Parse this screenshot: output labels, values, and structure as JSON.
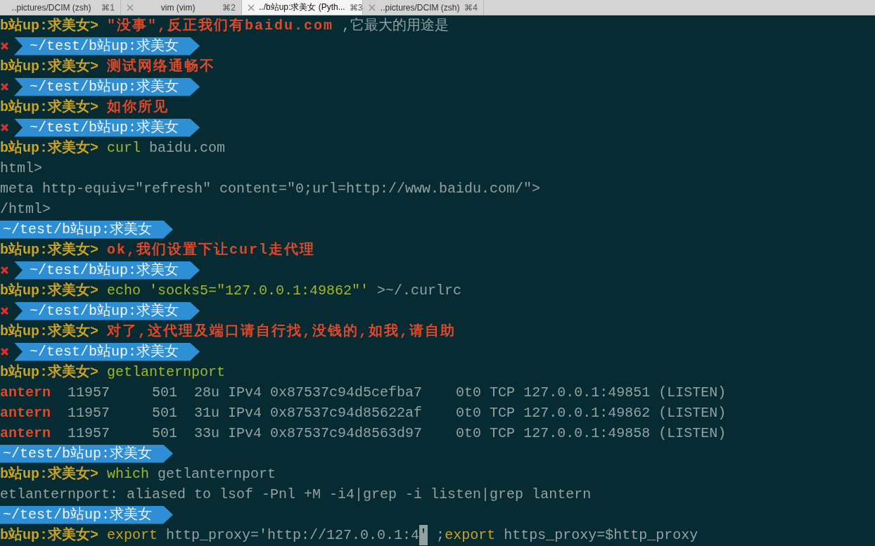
{
  "tabs": [
    {
      "label": "..pictures/DCIM (zsh)",
      "shortcut": "⌘1",
      "closable": false,
      "selected": false
    },
    {
      "label": "vim (vim)",
      "shortcut": "⌘2",
      "closable": true,
      "selected": false
    },
    {
      "label": "../b站up:求美女 (Pyth...",
      "shortcut": "⌘3",
      "closable": true,
      "selected": true
    },
    {
      "label": "..pictures/DCIM (zsh)",
      "shortcut": "⌘4",
      "closable": true,
      "selected": false
    }
  ],
  "lines": [
    {
      "kind": "prompt",
      "prompt": "b站up:求美女>",
      "segments": [
        {
          "kind": "comment",
          "text": "\"没事\",反正我们有baidu.com"
        },
        {
          "kind": "plain",
          "text": " ,它最大的用途是"
        }
      ]
    },
    {
      "kind": "path",
      "failed": true,
      "path": "~/test/b站up:求美女"
    },
    {
      "kind": "prompt",
      "prompt": "b站up:求美女>",
      "segments": [
        {
          "kind": "comment",
          "text": "测试网络通畅不"
        }
      ]
    },
    {
      "kind": "path",
      "failed": true,
      "path": "~/test/b站up:求美女"
    },
    {
      "kind": "prompt",
      "prompt": "b站up:求美女>",
      "segments": [
        {
          "kind": "comment",
          "text": "如你所见"
        }
      ]
    },
    {
      "kind": "path",
      "failed": true,
      "path": "~/test/b站up:求美女"
    },
    {
      "kind": "prompt",
      "prompt": "b站up:求美女>",
      "segments": [
        {
          "kind": "command",
          "text": "curl"
        },
        {
          "kind": "plain",
          "text": " baidu.com"
        }
      ]
    },
    {
      "kind": "output",
      "segments": [
        {
          "kind": "plain",
          "text": "html>"
        }
      ]
    },
    {
      "kind": "output",
      "segments": [
        {
          "kind": "plain",
          "text": "meta http-equiv=\"refresh\" content=\"0;url=http://www.baidu.com/\">"
        }
      ]
    },
    {
      "kind": "output",
      "segments": [
        {
          "kind": "plain",
          "text": "/html>"
        }
      ]
    },
    {
      "kind": "path",
      "failed": false,
      "path": "~/test/b站up:求美女"
    },
    {
      "kind": "prompt",
      "prompt": "b站up:求美女>",
      "segments": [
        {
          "kind": "comment",
          "text": "ok,我们设置下让curl走代理"
        }
      ]
    },
    {
      "kind": "path",
      "failed": true,
      "path": "~/test/b站up:求美女"
    },
    {
      "kind": "prompt",
      "prompt": "b站up:求美女>",
      "segments": [
        {
          "kind": "command",
          "text": "echo 'socks5=\"127.0.0.1:49862\"'"
        },
        {
          "kind": "plain",
          "text": " >~/.curlrc"
        }
      ]
    },
    {
      "kind": "path",
      "failed": true,
      "path": "~/test/b站up:求美女"
    },
    {
      "kind": "prompt",
      "prompt": "b站up:求美女>",
      "segments": [
        {
          "kind": "comment",
          "text": "对了,这代理及端口请自行找,没钱的,如我,请自助"
        }
      ]
    },
    {
      "kind": "path",
      "failed": true,
      "path": "~/test/b站up:求美女"
    },
    {
      "kind": "prompt",
      "prompt": "b站up:求美女>",
      "segments": [
        {
          "kind": "command",
          "text": "getlanternport"
        }
      ]
    },
    {
      "kind": "output",
      "segments": [
        {
          "kind": "name",
          "text": "antern"
        },
        {
          "kind": "plain",
          "text": "  11957     501  28u IPv4 0x87537c94d5cefba7    0t0 TCP 127.0.0.1:49851 (LISTEN)"
        }
      ]
    },
    {
      "kind": "output",
      "segments": [
        {
          "kind": "name",
          "text": "antern"
        },
        {
          "kind": "plain",
          "text": "  11957     501  31u IPv4 0x87537c94d85622af    0t0 TCP 127.0.0.1:49862 (LISTEN)"
        }
      ]
    },
    {
      "kind": "output",
      "segments": [
        {
          "kind": "name",
          "text": "antern"
        },
        {
          "kind": "plain",
          "text": "  11957     501  33u IPv4 0x87537c94d8563d97    0t0 TCP 127.0.0.1:49858 (LISTEN)"
        }
      ]
    },
    {
      "kind": "path",
      "failed": false,
      "path": "~/test/b站up:求美女"
    },
    {
      "kind": "prompt",
      "prompt": "b站up:求美女>",
      "segments": [
        {
          "kind": "command",
          "text": "which"
        },
        {
          "kind": "plain",
          "text": " getlanternport"
        }
      ]
    },
    {
      "kind": "output",
      "segments": [
        {
          "kind": "plain",
          "text": "etlanternport: aliased to lsof -Pnl +M -i4|grep -i listen|grep lantern"
        }
      ]
    },
    {
      "kind": "path",
      "failed": false,
      "path": "~/test/b站up:求美女"
    },
    {
      "kind": "prompt",
      "prompt": "b站up:求美女>",
      "segments": [
        {
          "kind": "keyword",
          "text": "export"
        },
        {
          "kind": "plain",
          "text": " http_proxy='http://127.0.0.1:4"
        },
        {
          "kind": "cursor",
          "text": "'"
        },
        {
          "kind": "plain",
          "text": " ;"
        },
        {
          "kind": "keyword",
          "text": "export"
        },
        {
          "kind": "plain",
          "text": " https_proxy=$http_proxy"
        }
      ]
    }
  ]
}
